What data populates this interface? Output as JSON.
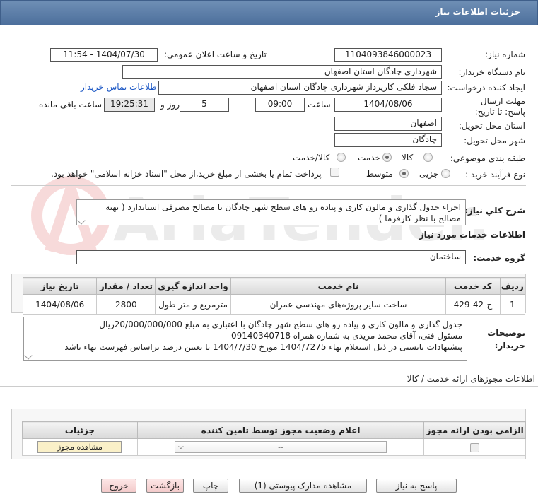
{
  "header": {
    "title": "جزئیات اطلاعات نیاز"
  },
  "form": {
    "need_number_label": "شماره نیاز:",
    "need_number": "1104093846000023",
    "announce_label": "تاریخ و ساعت اعلان عمومی:",
    "announce_value": "1404/07/30 - 11:54",
    "buyer_org_label": "نام دستگاه خریدار:",
    "buyer_org": "شهرداری چادگان استان اصفهان",
    "requester_label": "ایجاد کننده درخواست:",
    "requester": "سجاد فلکی کارپرداز شهرداری چادگان استان اصفهان",
    "contact_link": "اطلاعات تماس خریدار",
    "deadline_label": "مهلت ارسال پاسخ: تا تاریخ:",
    "deadline_date": "1404/08/06",
    "time_label": "ساعت",
    "deadline_time": "09:00",
    "days_value": "5",
    "days_label": "روز و",
    "remaining_time": "19:25:31",
    "remaining_label": "ساعت باقی مانده",
    "province_label": "استان محل تحویل:",
    "province": "اصفهان",
    "city_label": "شهر محل تحویل:",
    "city": "چادگان",
    "category_label": "طبقه بندی موضوعی:",
    "category_options": [
      "کالا",
      "خدمت",
      "کالا/خدمت"
    ],
    "category_selected": "خدمت",
    "process_label": "نوع فرآیند خرید :",
    "process_options": [
      "جزیی",
      "متوسط"
    ],
    "process_selected": "متوسط",
    "payment_note": "پرداخت تمام یا بخشی از مبلغ خرید،از محل \"اسناد خزانه اسلامی\" خواهد بود."
  },
  "description": {
    "label": "شرح کلي نياز:",
    "text": "اجراء جدول گذاری و مالون کاری و پیاده رو های سطح شهر چادگان با مصالح مصرفی استاندارد ( تهیه مصالح با نظر کارفرما )"
  },
  "services": {
    "section_title": "اطلاعات خدمات مورد نیاز",
    "group_label": "گروه خدمت:",
    "group_value": "ساختمان",
    "columns": [
      "ردیف",
      "کد خدمت",
      "نام خدمت",
      "واحد اندازه گیری",
      "تعداد / مقدار",
      "تاریخ نیاز"
    ],
    "rows": [
      [
        "1",
        "ج-42-429",
        "ساخت سایر پروژه‌های مهندسی عمران",
        "مترمربع و متر طول",
        "2800",
        "1404/08/06"
      ]
    ]
  },
  "buyer_notes": {
    "label": "توضیحات خریدار:",
    "line1": "جدول گذاری و مالون کاری و پیاده رو های سطح شهر چادگان با اعتباری به مبلغ  20/000/000/000ریال",
    "line2": "مسئول فنی، آقای محمد مریدی به شماره همراه 09140340718",
    "line3": "پیشنهادات بایستی در ذیل استعلام بهاء 1404/7275 مورخ 1404/7/30 با تعیین درصد براساس فهرست بهاء باشد"
  },
  "permits": {
    "section_title": "اطلاعات مجوزهای ارائه خدمت / کالا",
    "columns": [
      "الزامی بودن ارائه مجوز",
      "اعلام وضعیت مجوز توسط تامین کننده",
      "جزئیات"
    ],
    "select_value": "--",
    "view_button": "مشاهده مجوز"
  },
  "buttons": {
    "reply": "پاسخ به نیاز",
    "attachments": "مشاهده مدارک پیوستی (1)",
    "print": "چاپ",
    "back": "بازگشت",
    "exit": "خروج"
  },
  "watermark": "AriaTender.net"
}
